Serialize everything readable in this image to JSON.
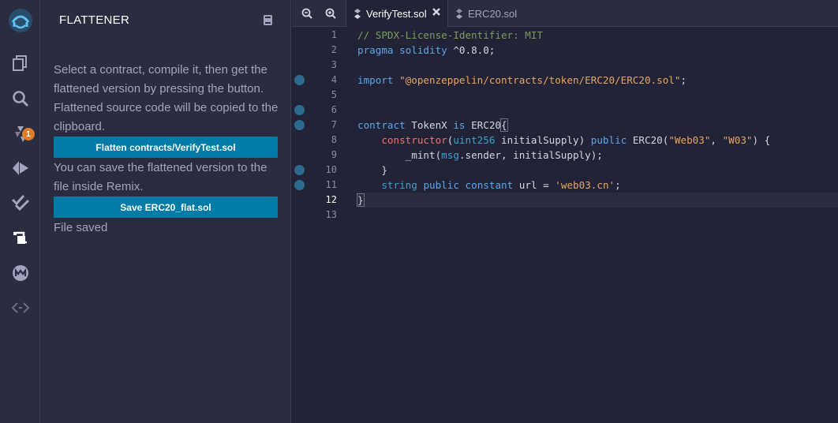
{
  "sidebar_icons": [
    {
      "name": "remix-logo-icon"
    },
    {
      "name": "file-explorer-icon"
    },
    {
      "name": "search-icon"
    },
    {
      "name": "solidity-compiler-icon",
      "badge": "1"
    },
    {
      "name": "deploy-run-icon"
    },
    {
      "name": "unit-testing-icon"
    },
    {
      "name": "flattener-icon"
    },
    {
      "name": "plugin-m-icon"
    },
    {
      "name": "plugin-code-icon"
    }
  ],
  "panel": {
    "title": "FLATTENER",
    "description1": "Select a contract, compile it, then get the flattened version by pressing the button. Flattened source code will be copied to the clipboard.",
    "flatten_button": "Flatten contracts/VerifyTest.sol",
    "description2": "You can save the flattened version to the file inside Remix.",
    "save_button": "Save ERC20_flat.sol",
    "status": "File saved"
  },
  "editor": {
    "tabs": [
      {
        "label": "VerifyTest.sol",
        "active": true
      },
      {
        "label": "ERC20.sol",
        "active": false
      }
    ],
    "current_line": "12",
    "lines": [
      {
        "num": "1",
        "bp": false,
        "tokens": [
          {
            "c": "c-comment",
            "t": "// SPDX-License-Identifier: MIT"
          }
        ]
      },
      {
        "num": "2",
        "bp": false,
        "tokens": [
          {
            "c": "c-kw",
            "t": "pragma solidity"
          },
          {
            "c": "c-plain",
            "t": " ^0.8.0;"
          }
        ]
      },
      {
        "num": "3",
        "bp": false,
        "tokens": []
      },
      {
        "num": "4",
        "bp": true,
        "tokens": [
          {
            "c": "c-kw",
            "t": "import"
          },
          {
            "c": "c-plain",
            "t": " "
          },
          {
            "c": "c-str",
            "t": "\"@openzeppelin/contracts/token/ERC20/ERC20.sol\""
          },
          {
            "c": "c-plain",
            "t": ";"
          }
        ]
      },
      {
        "num": "5",
        "bp": false,
        "tokens": []
      },
      {
        "num": "6",
        "bp": true,
        "tokens": []
      },
      {
        "num": "7",
        "bp": true,
        "tokens": [
          {
            "c": "c-kw",
            "t": "contract"
          },
          {
            "c": "c-plain",
            "t": " TokenX "
          },
          {
            "c": "c-kw",
            "t": "is"
          },
          {
            "c": "c-plain",
            "t": " ERC20"
          },
          {
            "c": "c-br",
            "t": "{"
          }
        ]
      },
      {
        "num": "8",
        "bp": false,
        "tokens": [
          {
            "c": "c-plain",
            "t": "    "
          },
          {
            "c": "c-fn",
            "t": "constructor"
          },
          {
            "c": "c-plain",
            "t": "("
          },
          {
            "c": "c-type",
            "t": "uint256"
          },
          {
            "c": "c-plain",
            "t": " initialSupply) "
          },
          {
            "c": "c-kw",
            "t": "public"
          },
          {
            "c": "c-plain",
            "t": " ERC20("
          },
          {
            "c": "c-str",
            "t": "\"Web03\""
          },
          {
            "c": "c-plain",
            "t": ", "
          },
          {
            "c": "c-str",
            "t": "\"W03\""
          },
          {
            "c": "c-plain",
            "t": ") {"
          }
        ]
      },
      {
        "num": "9",
        "bp": false,
        "tokens": [
          {
            "c": "c-plain",
            "t": "        _mint("
          },
          {
            "c": "c-type",
            "t": "msg"
          },
          {
            "c": "c-plain",
            "t": ".sender, initialSupply);"
          }
        ]
      },
      {
        "num": "10",
        "bp": true,
        "tokens": [
          {
            "c": "c-plain",
            "t": "    }"
          }
        ]
      },
      {
        "num": "11",
        "bp": true,
        "tokens": [
          {
            "c": "c-plain",
            "t": "    "
          },
          {
            "c": "c-type",
            "t": "string"
          },
          {
            "c": "c-plain",
            "t": " "
          },
          {
            "c": "c-kw",
            "t": "public"
          },
          {
            "c": "c-plain",
            "t": " "
          },
          {
            "c": "c-kw",
            "t": "constant"
          },
          {
            "c": "c-plain",
            "t": " url = "
          },
          {
            "c": "c-str",
            "t": "'web03.cn'"
          },
          {
            "c": "c-plain",
            "t": ";"
          }
        ]
      },
      {
        "num": "12",
        "bp": false,
        "tokens": [
          {
            "c": "c-br",
            "t": "}"
          }
        ]
      },
      {
        "num": "13",
        "bp": false,
        "tokens": []
      }
    ]
  },
  "colors": {
    "accent": "#007aa6",
    "badge": "#e07b28",
    "panel_bg": "#2a2c3f",
    "editor_bg": "#222336"
  }
}
